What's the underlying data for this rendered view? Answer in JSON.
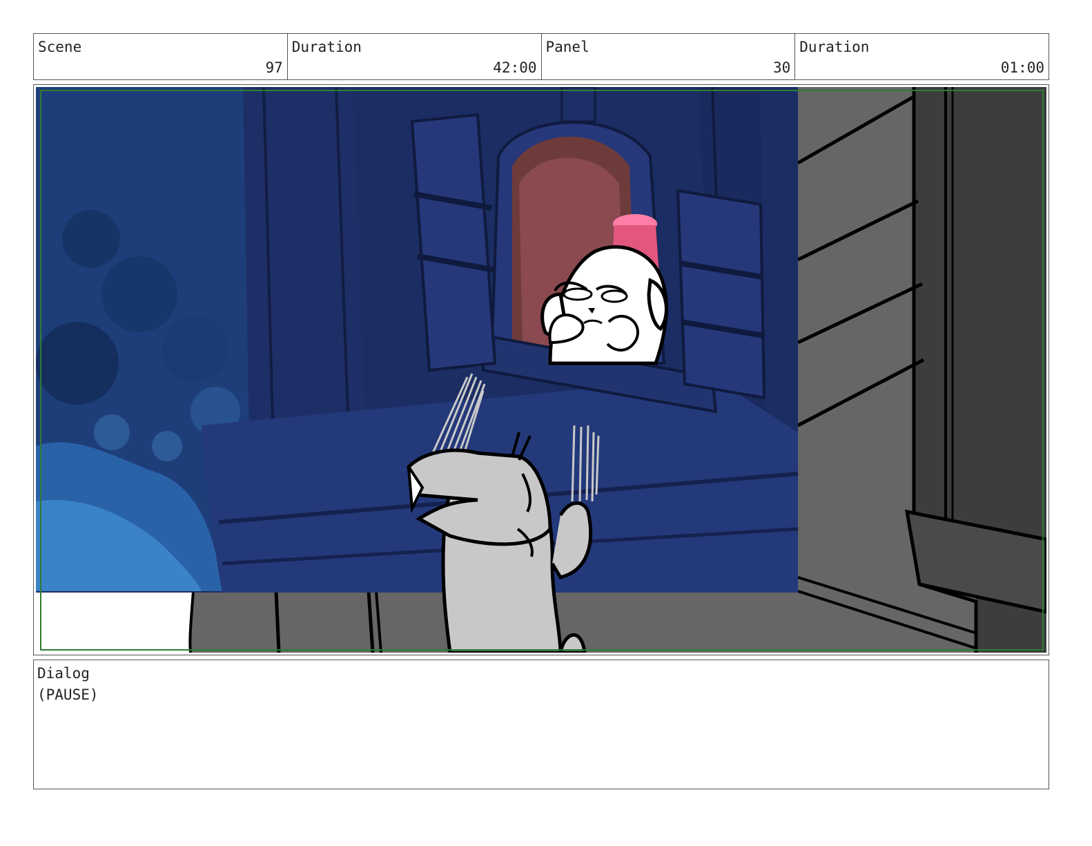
{
  "header": {
    "cells": [
      {
        "label": "Scene",
        "value": "97"
      },
      {
        "label": "Duration",
        "value": "42:00"
      },
      {
        "label": "Panel",
        "value": "30"
      },
      {
        "label": "Duration",
        "value": "01:00"
      }
    ]
  },
  "panel": {
    "safe_frame_color": "#2e7d32",
    "night_sky_color": "#1b2d63",
    "rough_fill_color": "#666666"
  },
  "dialog": {
    "label": "Dialog",
    "text": "(PAUSE)"
  }
}
